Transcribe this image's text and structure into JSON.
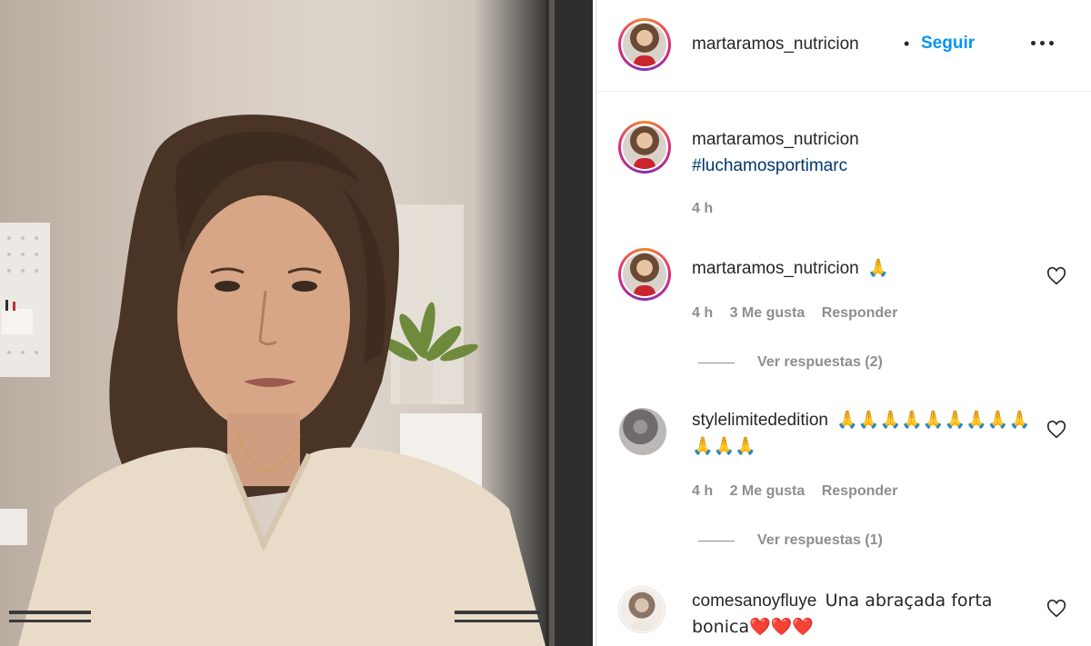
{
  "header": {
    "username": "martaramos_nutricion",
    "separator": "•",
    "follow_label": "Seguir"
  },
  "caption": {
    "username": "martaramos_nutricion",
    "hashtag": "#luchamosportimarc",
    "time": "4 h"
  },
  "comments": [
    {
      "username": "martaramos_nutricion",
      "text": "🙏",
      "time": "4 h",
      "likes": "3 Me gusta",
      "reply_label": "Responder",
      "view_replies": "Ver respuestas (2)"
    },
    {
      "username": "stylelimitededition",
      "text": "🙏🙏🙏🙏🙏🙏🙏🙏🙏🙏🙏🙏",
      "time": "4 h",
      "likes": "2 Me gusta",
      "reply_label": "Responder",
      "view_replies": "Ver respuestas (1)"
    },
    {
      "username": "comesanoyfluye",
      "text": "Una abraçada forta bonica❤️❤️❤️"
    }
  ],
  "icons": {
    "more": "more-options-icon",
    "heart": "heart-outline-icon"
  },
  "colors": {
    "follow": "#0095f6",
    "hashtag": "#00376b",
    "secondary_text": "#8e8e8e"
  }
}
